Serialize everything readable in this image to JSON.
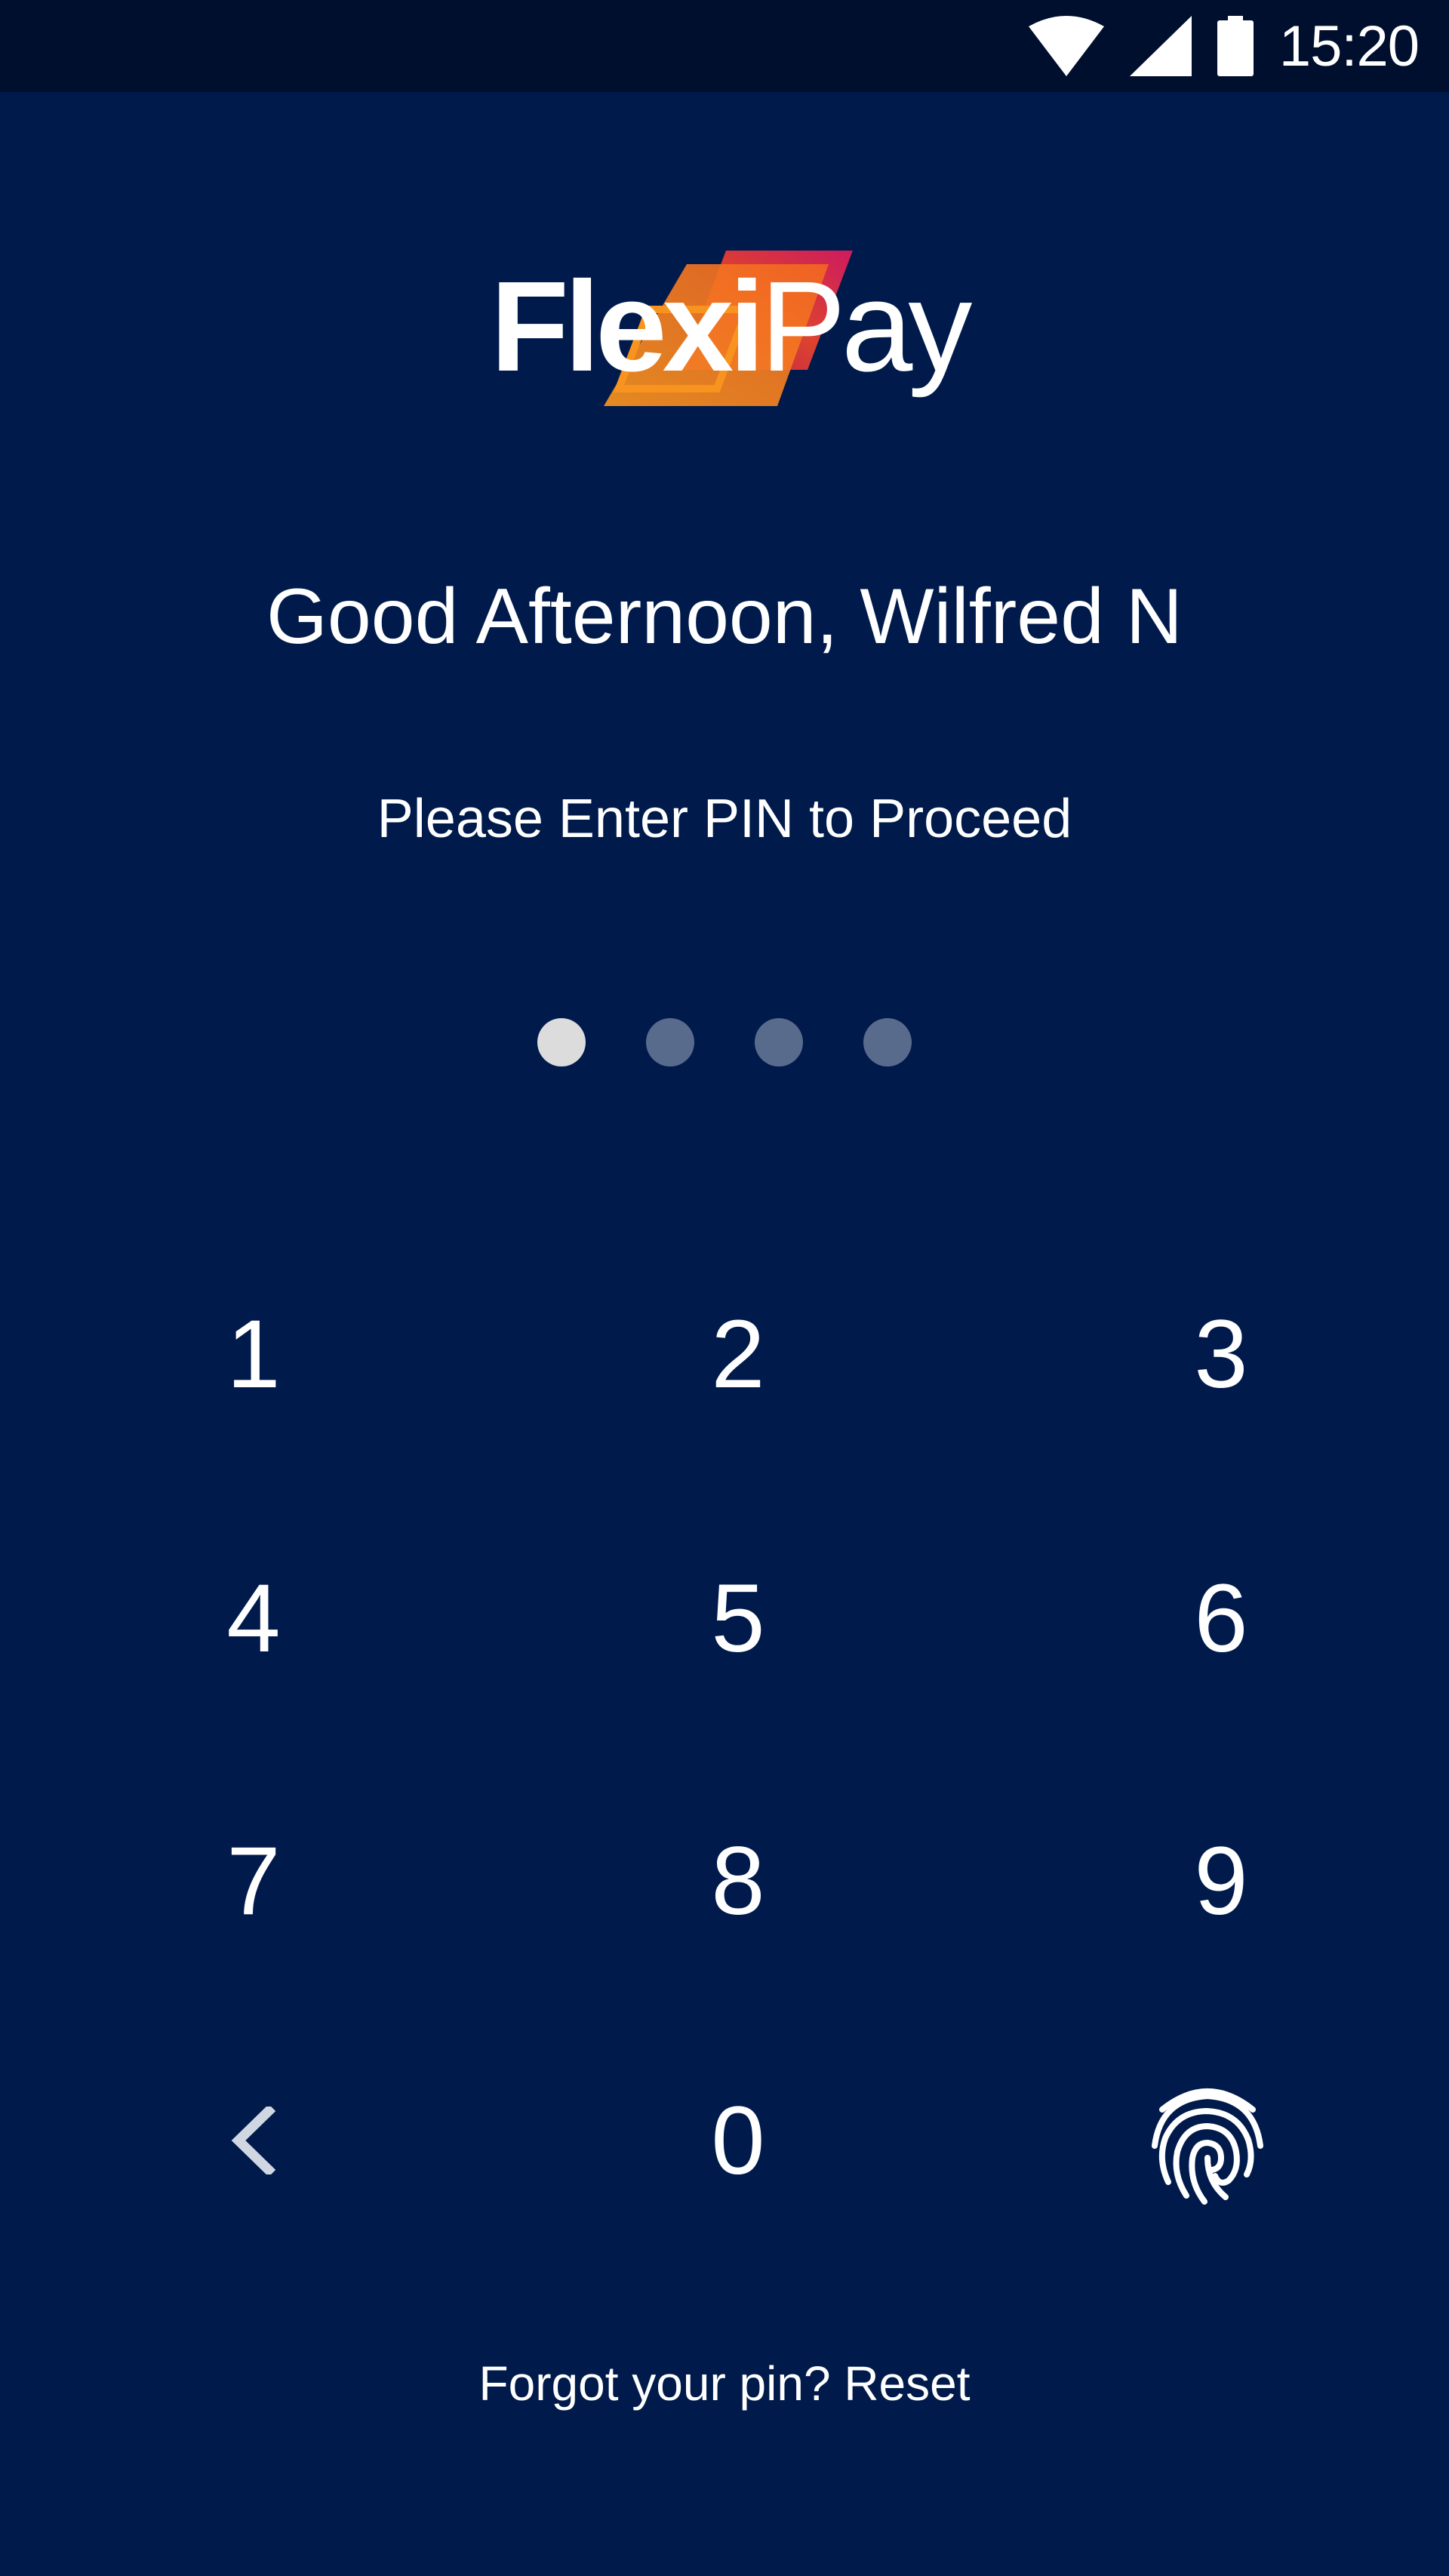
{
  "status_bar": {
    "time": "15:20",
    "icons": [
      "wifi-icon",
      "cellular-signal-icon",
      "battery-icon"
    ]
  },
  "logo": {
    "text_bold": "Flexi",
    "text_regular": "Pay",
    "colors": [
      "#f7931e",
      "#e8452c",
      "#c2185b"
    ]
  },
  "greeting": "Good Afternoon, Wilfred N",
  "instruction": "Please Enter PIN to Proceed",
  "pin": {
    "length": 4,
    "entered": 1
  },
  "keypad": {
    "keys": [
      "1",
      "2",
      "3",
      "4",
      "5",
      "6",
      "7",
      "8",
      "9",
      "0"
    ],
    "back_icon": "chevron-left-icon",
    "biometric_icon": "fingerprint-icon"
  },
  "footer": {
    "forgot_link": "Forgot your pin? Reset"
  },
  "colors": {
    "background": "#001b4b",
    "status_bar": "#000f2e",
    "dot_filled": "#dcdcdc",
    "dot_empty": "#596b8c"
  }
}
